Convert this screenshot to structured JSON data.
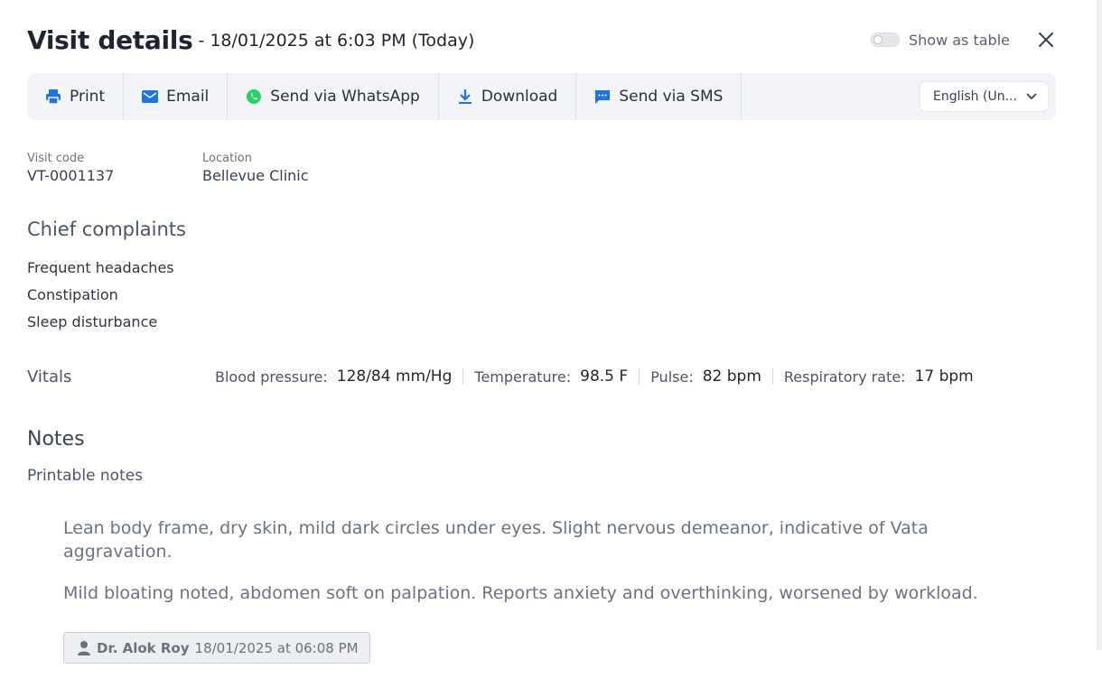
{
  "header": {
    "title": "Visit details",
    "subtitle": "- 18/01/2025 at 6:03 PM (Today)",
    "toggle_label": "Show as table"
  },
  "toolbar": {
    "buttons": [
      {
        "label": "Print",
        "icon": "printer-icon"
      },
      {
        "label": "Email",
        "icon": "envelope-icon"
      },
      {
        "label": "Send via WhatsApp",
        "icon": "whatsapp-icon"
      },
      {
        "label": "Download",
        "icon": "download-icon"
      },
      {
        "label": "Send via SMS",
        "icon": "sms-icon"
      }
    ],
    "language": "English (Un..."
  },
  "visit": {
    "code_label": "Visit code",
    "code": "VT-0001137",
    "location_label": "Location",
    "location": "Bellevue Clinic"
  },
  "complaints": {
    "heading": "Chief complaints",
    "items": [
      "Frequent headaches",
      "Constipation",
      "Sleep disturbance"
    ]
  },
  "vitals": {
    "heading": "Vitals",
    "items": [
      {
        "label": "Blood pressure:",
        "value": "128/84 mm/Hg"
      },
      {
        "label": "Temperature:",
        "value": "98.5 F"
      },
      {
        "label": "Pulse:",
        "value": "82 bpm"
      },
      {
        "label": "Respiratory rate:",
        "value": "17 bpm"
      }
    ]
  },
  "notes": {
    "heading": "Notes",
    "printable_heading": "Printable notes",
    "paragraphs": [
      "Lean body frame, dry skin, mild dark circles under eyes. Slight nervous demeanor, indicative of Vata aggravation.",
      "Mild bloating noted, abdomen soft on palpation. Reports anxiety and overthinking, worsened by workload."
    ],
    "author": "Dr. Alok Roy",
    "timestamp": "18/01/2025 at 06:08 PM"
  },
  "colors": {
    "accent": "#1a73e8",
    "whatsapp": "#25d366",
    "toolbar_bg": "#f3f4f7"
  }
}
